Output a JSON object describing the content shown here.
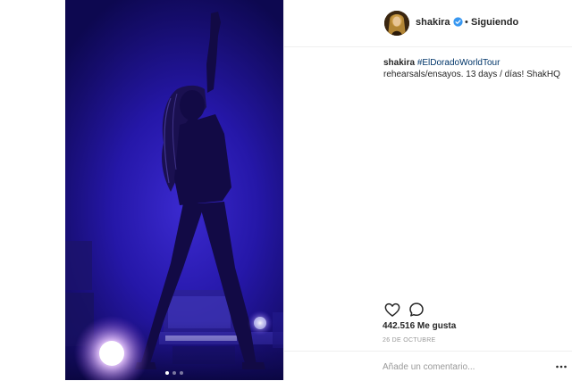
{
  "post": {
    "photo_icon": "concert-photo",
    "carousel": {
      "count": 3,
      "active": 1
    }
  },
  "header": {
    "username": "shakira",
    "separator": "•",
    "follow_status": "Siguiendo",
    "verified_icon": "verified-badge-icon"
  },
  "caption": {
    "username": "shakira",
    "hashtag": "#ElDoradoWorldTour",
    "text": "rehearsals/ensayos. 13 days / días! ShakHQ"
  },
  "actions": {
    "like_icon": "heart-icon",
    "comment_icon": "comment-icon"
  },
  "likes": "442.516 Me gusta",
  "timestamp": "26 DE OCTUBRE",
  "comment": {
    "placeholder": "Añade un comentario...",
    "more_icon": "more-options-icon"
  },
  "colors": {
    "hashtag": "#003569",
    "verified": "#3897f0",
    "stage_blue": "#2517a8"
  }
}
